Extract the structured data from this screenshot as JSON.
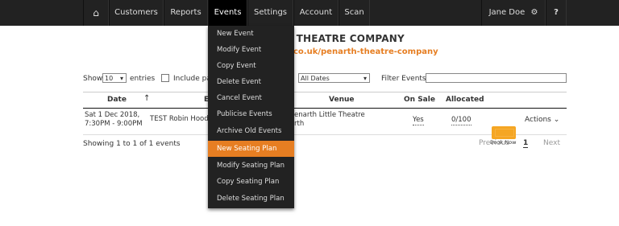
{
  "nav": {
    "home_icon": "home-icon",
    "items": [
      "Customers",
      "Reports",
      "Events",
      "Settings",
      "Account",
      "Scan"
    ],
    "active": "Events",
    "user": "Jane Doe",
    "gear_icon": "gear-icon",
    "help": "?"
  },
  "page": {
    "title": "H THEATRE COMPANY",
    "link": "co.uk/penarth-theatre-company"
  },
  "controls": {
    "show": "Show",
    "show_value": "10",
    "entries": "entries",
    "include": "Include pa",
    "dates": "All Dates",
    "filter_label": "Filter Events",
    "filter_placeholder": ""
  },
  "table": {
    "headers": [
      "Date",
      "E",
      "Venue",
      "On Sale",
      "Allocated"
    ],
    "row": {
      "date_line1": "Sat 1 Dec 2018,",
      "date_line2": "7:30PM - 9:00PM",
      "event": "TEST Robin Hood",
      "venue_line1": "enarth Little Theatre",
      "venue_line2": "rth",
      "on_sale": "Yes",
      "allocated": "0/100",
      "book_now": "Book Now",
      "actions": "Actions ⌄"
    }
  },
  "footer": {
    "showing": "Showing 1 to 1 of 1 events",
    "previous": "Previous",
    "page": "1",
    "next": "Next"
  },
  "menu": {
    "items": [
      "New Event",
      "Modify Event",
      "Copy Event",
      "Delete Event",
      "Cancel Event",
      "Publicise Events",
      "Archive Old Events",
      "New Seating Plan",
      "Modify Seating Plan",
      "Copy Seating Plan",
      "Delete Seating Plan"
    ],
    "highlighted": "New Seating Plan"
  },
  "colors": {
    "nav_bg": "#222222",
    "accent": "#e67e22"
  }
}
